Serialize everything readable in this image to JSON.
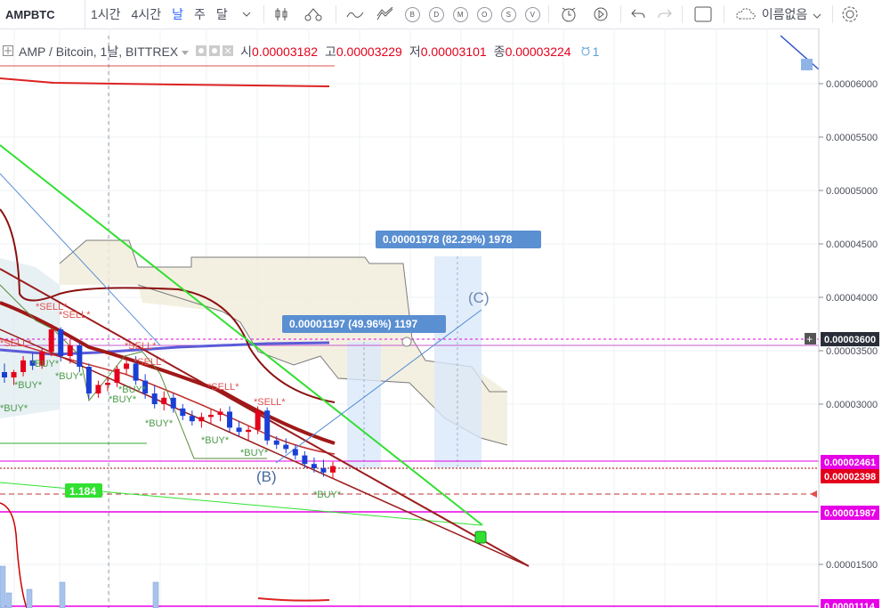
{
  "toolbar": {
    "symbol": "AMPBTC",
    "intervals": [
      "1시간",
      "4시간",
      "날",
      "주",
      "달"
    ],
    "indicator_circles": [
      "B",
      "D",
      "M",
      "O",
      "S",
      "V"
    ],
    "layout_name": "이름없음",
    "icons": [
      "chevron-down-icon",
      "candles-icon",
      "compare-icon",
      "indicators-icon",
      "templates-icon",
      "alert-icon",
      "replay-icon",
      "undo-icon",
      "redo-icon",
      "fullscreen-icon",
      "cloud-icon",
      "gear-icon"
    ]
  },
  "legend": {
    "title": "AMP / Bitcoin, 1날, BITTREX",
    "open_label": "시",
    "open": "0.00003182",
    "high_label": "고",
    "high": "0.00003229",
    "low_label": "저",
    "low": "0.00003101",
    "close_label": "종",
    "close": "0.00003224",
    "alert_count": "1"
  },
  "chart_data": {
    "type": "candlestick",
    "symbol": "AMP / Bitcoin",
    "interval": "1날",
    "exchange": "BITTREX",
    "y_axis": {
      "ticks": [
        "0.00006000",
        "0.00005500",
        "0.00005000",
        "0.00004500",
        "0.00004000",
        "0.00003500",
        "0.00003000",
        "0.00001500"
      ],
      "range": [
        1.1e-05,
        6.4e-05
      ]
    },
    "price_labels": [
      {
        "value": "0.00003600",
        "color": "#2a2e39"
      },
      {
        "value": "0.00002461",
        "color": "#e600e6"
      },
      {
        "value": "0.00002398",
        "color": "#e3001b"
      },
      {
        "value": "0.00001987",
        "color": "#e600e6"
      },
      {
        "value": "0.00001114",
        "color": "#e600e6"
      }
    ],
    "measure_labels": [
      {
        "text": "0.00001978 (82.29%) 1978"
      },
      {
        "text": "0.00001197 (49.96%) 1197"
      }
    ],
    "wave_labels": [
      "(B)",
      "(C)"
    ],
    "level_label": "1.184",
    "signals": [
      "SELL",
      "SELL",
      "SELL",
      "SELL",
      "SELL",
      "SELL",
      "SELL",
      "BUY",
      "BUY",
      "BUY",
      "BUY",
      "BUY",
      "BUY",
      "BUY",
      "BUY",
      "BUY",
      "BUY"
    ],
    "candles": [
      {
        "o": 3.3e-05,
        "h": 3.38e-05,
        "l": 3.2e-05,
        "c": 3.25e-05
      },
      {
        "o": 3.25e-05,
        "h": 3.32e-05,
        "l": 3.18e-05,
        "c": 3.3e-05
      },
      {
        "o": 3.3e-05,
        "h": 3.45e-05,
        "l": 3.26e-05,
        "c": 3.41e-05
      },
      {
        "o": 3.41e-05,
        "h": 3.48e-05,
        "l": 3.32e-05,
        "c": 3.36e-05
      },
      {
        "o": 3.36e-05,
        "h": 3.52e-05,
        "l": 3.33e-05,
        "c": 3.49e-05
      },
      {
        "o": 3.49e-05,
        "h": 3.75e-05,
        "l": 3.45e-05,
        "c": 3.7e-05
      },
      {
        "o": 3.7e-05,
        "h": 3.72e-05,
        "l": 3.4e-05,
        "c": 3.45e-05
      },
      {
        "o": 3.45e-05,
        "h": 3.6e-05,
        "l": 3.38e-05,
        "c": 3.55e-05
      },
      {
        "o": 3.55e-05,
        "h": 3.58e-05,
        "l": 3.3e-05,
        "c": 3.35e-05
      },
      {
        "o": 3.35e-05,
        "h": 3.38e-05,
        "l": 3.05e-05,
        "c": 3.1e-05
      },
      {
        "o": 3.1e-05,
        "h": 3.22e-05,
        "l": 3.06e-05,
        "c": 3.18e-05
      },
      {
        "o": 3.18e-05,
        "h": 3.25e-05,
        "l": 3.12e-05,
        "c": 3.2e-05
      },
      {
        "o": 3.2e-05,
        "h": 3.36e-05,
        "l": 3.16e-05,
        "c": 3.33e-05
      },
      {
        "o": 3.33e-05,
        "h": 3.42e-05,
        "l": 3.28e-05,
        "c": 3.38e-05
      },
      {
        "o": 3.38e-05,
        "h": 3.45e-05,
        "l": 3.18e-05,
        "c": 3.22e-05
      },
      {
        "o": 3.22e-05,
        "h": 3.28e-05,
        "l": 3.05e-05,
        "c": 3.1e-05
      },
      {
        "o": 3.1e-05,
        "h": 3.18e-05,
        "l": 2.96e-05,
        "c": 3e-05
      },
      {
        "o": 3e-05,
        "h": 3.12e-05,
        "l": 2.94e-05,
        "c": 3.06e-05
      },
      {
        "o": 3.06e-05,
        "h": 3.1e-05,
        "l": 2.92e-05,
        "c": 2.96e-05
      },
      {
        "o": 2.96e-05,
        "h": 3e-05,
        "l": 2.85e-05,
        "c": 2.89e-05
      },
      {
        "o": 2.89e-05,
        "h": 2.94e-05,
        "l": 2.8e-05,
        "c": 2.84e-05
      },
      {
        "o": 2.84e-05,
        "h": 2.92e-05,
        "l": 2.78e-05,
        "c": 2.88e-05
      },
      {
        "o": 2.88e-05,
        "h": 2.95e-05,
        "l": 2.82e-05,
        "c": 2.9e-05
      },
      {
        "o": 2.9e-05,
        "h": 2.96e-05,
        "l": 2.84e-05,
        "c": 2.93e-05
      },
      {
        "o": 2.93e-05,
        "h": 2.98e-05,
        "l": 2.74e-05,
        "c": 2.78e-05
      },
      {
        "o": 2.78e-05,
        "h": 2.84e-05,
        "l": 2.7e-05,
        "c": 2.74e-05
      },
      {
        "o": 2.74e-05,
        "h": 2.8e-05,
        "l": 2.66e-05,
        "c": 2.76e-05
      },
      {
        "o": 2.76e-05,
        "h": 2.98e-05,
        "l": 2.72e-05,
        "c": 2.94e-05
      },
      {
        "o": 2.94e-05,
        "h": 2.97e-05,
        "l": 2.62e-05,
        "c": 2.66e-05
      },
      {
        "o": 2.66e-05,
        "h": 2.7e-05,
        "l": 2.58e-05,
        "c": 2.62e-05
      },
      {
        "o": 2.62e-05,
        "h": 2.68e-05,
        "l": 2.54e-05,
        "c": 2.58e-05
      },
      {
        "o": 2.58e-05,
        "h": 2.62e-05,
        "l": 2.48e-05,
        "c": 2.52e-05
      },
      {
        "o": 2.52e-05,
        "h": 2.56e-05,
        "l": 2.4e-05,
        "c": 2.44e-05
      },
      {
        "o": 2.44e-05,
        "h": 2.5e-05,
        "l": 2.36e-05,
        "c": 2.4e-05
      },
      {
        "o": 2.4e-05,
        "h": 2.48e-05,
        "l": 2.32e-05,
        "c": 2.36e-05
      },
      {
        "o": 2.36e-05,
        "h": 2.46e-05,
        "l": 2.3e-05,
        "c": 2.42e-05
      }
    ]
  }
}
